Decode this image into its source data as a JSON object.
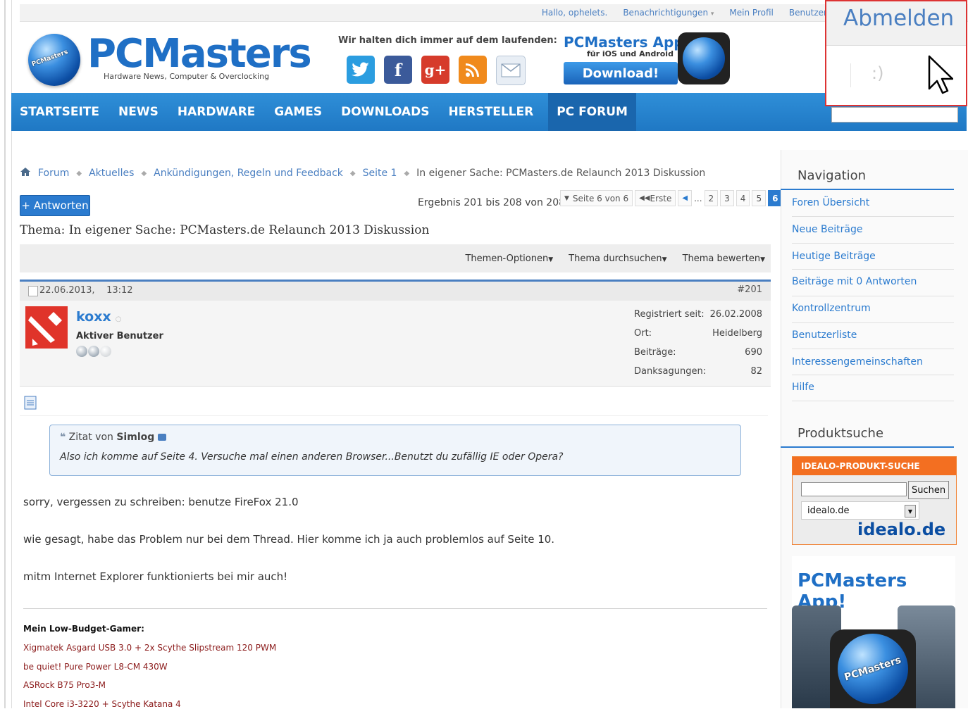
{
  "topbar": {
    "greeting": "Hallo, ophelets.",
    "notifications": "Benachrichtigungen",
    "my_profile": "Mein Profil",
    "users_cut": "Benutzer"
  },
  "logo": {
    "title": "PCMasters",
    "subtitle": "Hardware News, Computer & Overclocking",
    "globe_label": "PCMasters"
  },
  "follow": {
    "text": "Wir halten dich immer auf dem laufenden:",
    "icons": [
      "twitter-icon",
      "facebook-icon",
      "googleplus-icon",
      "rss-icon",
      "mail-icon"
    ]
  },
  "app_promo": {
    "title": "PCMasters Apps!",
    "subtitle": "für iOS und Android",
    "button": "Download!"
  },
  "nav": {
    "items": [
      "STARTSEITE",
      "NEWS",
      "HARDWARE",
      "GAMES",
      "DOWNLOADS",
      "HERSTELLER",
      "PC FORUM"
    ],
    "active": "PC FORUM"
  },
  "popup": {
    "title": "Abmelden",
    "glyph": ":)"
  },
  "breadcrumb": {
    "items": [
      "Forum",
      "Aktuelles",
      "Ankündigungen, Regeln und Feedback",
      "Seite 1"
    ],
    "current": "In eigener Sache: PCMasters.de Relaunch 2013 Diskussion"
  },
  "reply_button": "+ Antworten",
  "results": "Ergebnis 201 bis 208 von 208",
  "pager": {
    "label": "Seite 6 von 6",
    "first": "Erste",
    "ellipsis": "...",
    "pages": [
      "2",
      "3",
      "4",
      "5"
    ],
    "current": "6"
  },
  "thread_title": "Thema: In eigener Sache: PCMasters.de Relaunch 2013 Diskussion",
  "tools": [
    "Themen-Optionen",
    "Thema durchsuchen",
    "Thema bewerten"
  ],
  "post": {
    "date": "22.06.2013,",
    "time": "13:12",
    "number": "#201",
    "username": "koxx",
    "user_title": "Aktiver Benutzer",
    "stats": [
      {
        "label": "Registriert seit:",
        "value": "26.02.2008"
      },
      {
        "label": "Ort:",
        "value": "Heidelberg"
      },
      {
        "label": "Beiträge:",
        "value": "690"
      },
      {
        "label": "Danksagungen:",
        "value": "82"
      }
    ],
    "quote": {
      "prefix": "Zitat von",
      "author": "Simlog",
      "text": "Also ich komme auf Seite 4. Versuche mal einen anderen Browser...Benutzt du zufällig IE oder Opera?"
    },
    "paragraphs": [
      "sorry, vergessen zu schreiben: benutze FireFox 21.0",
      "wie gesagt, habe das Problem nur bei dem Thread. Hier komme ich ja auch problemlos auf Seite 10.",
      "mitm Internet Explorer funktionierts bei mir auch!"
    ],
    "signature": {
      "heading": "Mein Low-Budget-Gamer:",
      "lines": [
        "Xigmatek Asgard USB 3.0 + 2x Scythe Slipstream 120 PWM",
        "be quiet! Pure Power L8-CM 430W",
        "ASRock B75 Pro3-M",
        "Intel Core i3-3220 + Scythe Katana 4"
      ]
    }
  },
  "sidebar": {
    "nav_heading": "Navigation",
    "nav_links": [
      "Foren Übersicht",
      "Neue Beiträge",
      "Heutige Beiträge",
      "Beiträge mit 0 Antworten",
      "Kontrollzentrum",
      "Benutzerliste",
      "Interessengemeinschaften",
      "Hilfe"
    ],
    "product_heading": "Produktsuche",
    "idealo": {
      "header": "IDEALO-PRODUKT-SUCHE",
      "button": "Suchen",
      "select": "idealo.de",
      "logo": "idealo.de"
    },
    "app_ad": {
      "title": "PCMasters App!",
      "globe_label": "PCMasters"
    }
  },
  "colors": {
    "accent": "#2b7bcf",
    "nav": "#1f78c4",
    "idealo": "#f36f21",
    "popup_border": "#dd3333"
  }
}
